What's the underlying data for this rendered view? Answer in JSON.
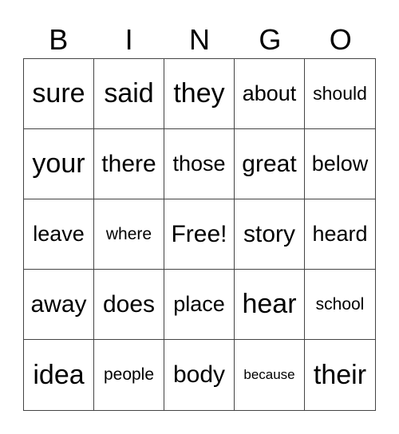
{
  "header": [
    "B",
    "I",
    "N",
    "G",
    "O"
  ],
  "cells": [
    "sure",
    "said",
    "they",
    "about",
    "should",
    "your",
    "there",
    "those",
    "great",
    "below",
    "leave",
    "where",
    "Free!",
    "story",
    "heard",
    "away",
    "does",
    "place",
    "hear",
    "school",
    "idea",
    "people",
    "body",
    "because",
    "their"
  ]
}
